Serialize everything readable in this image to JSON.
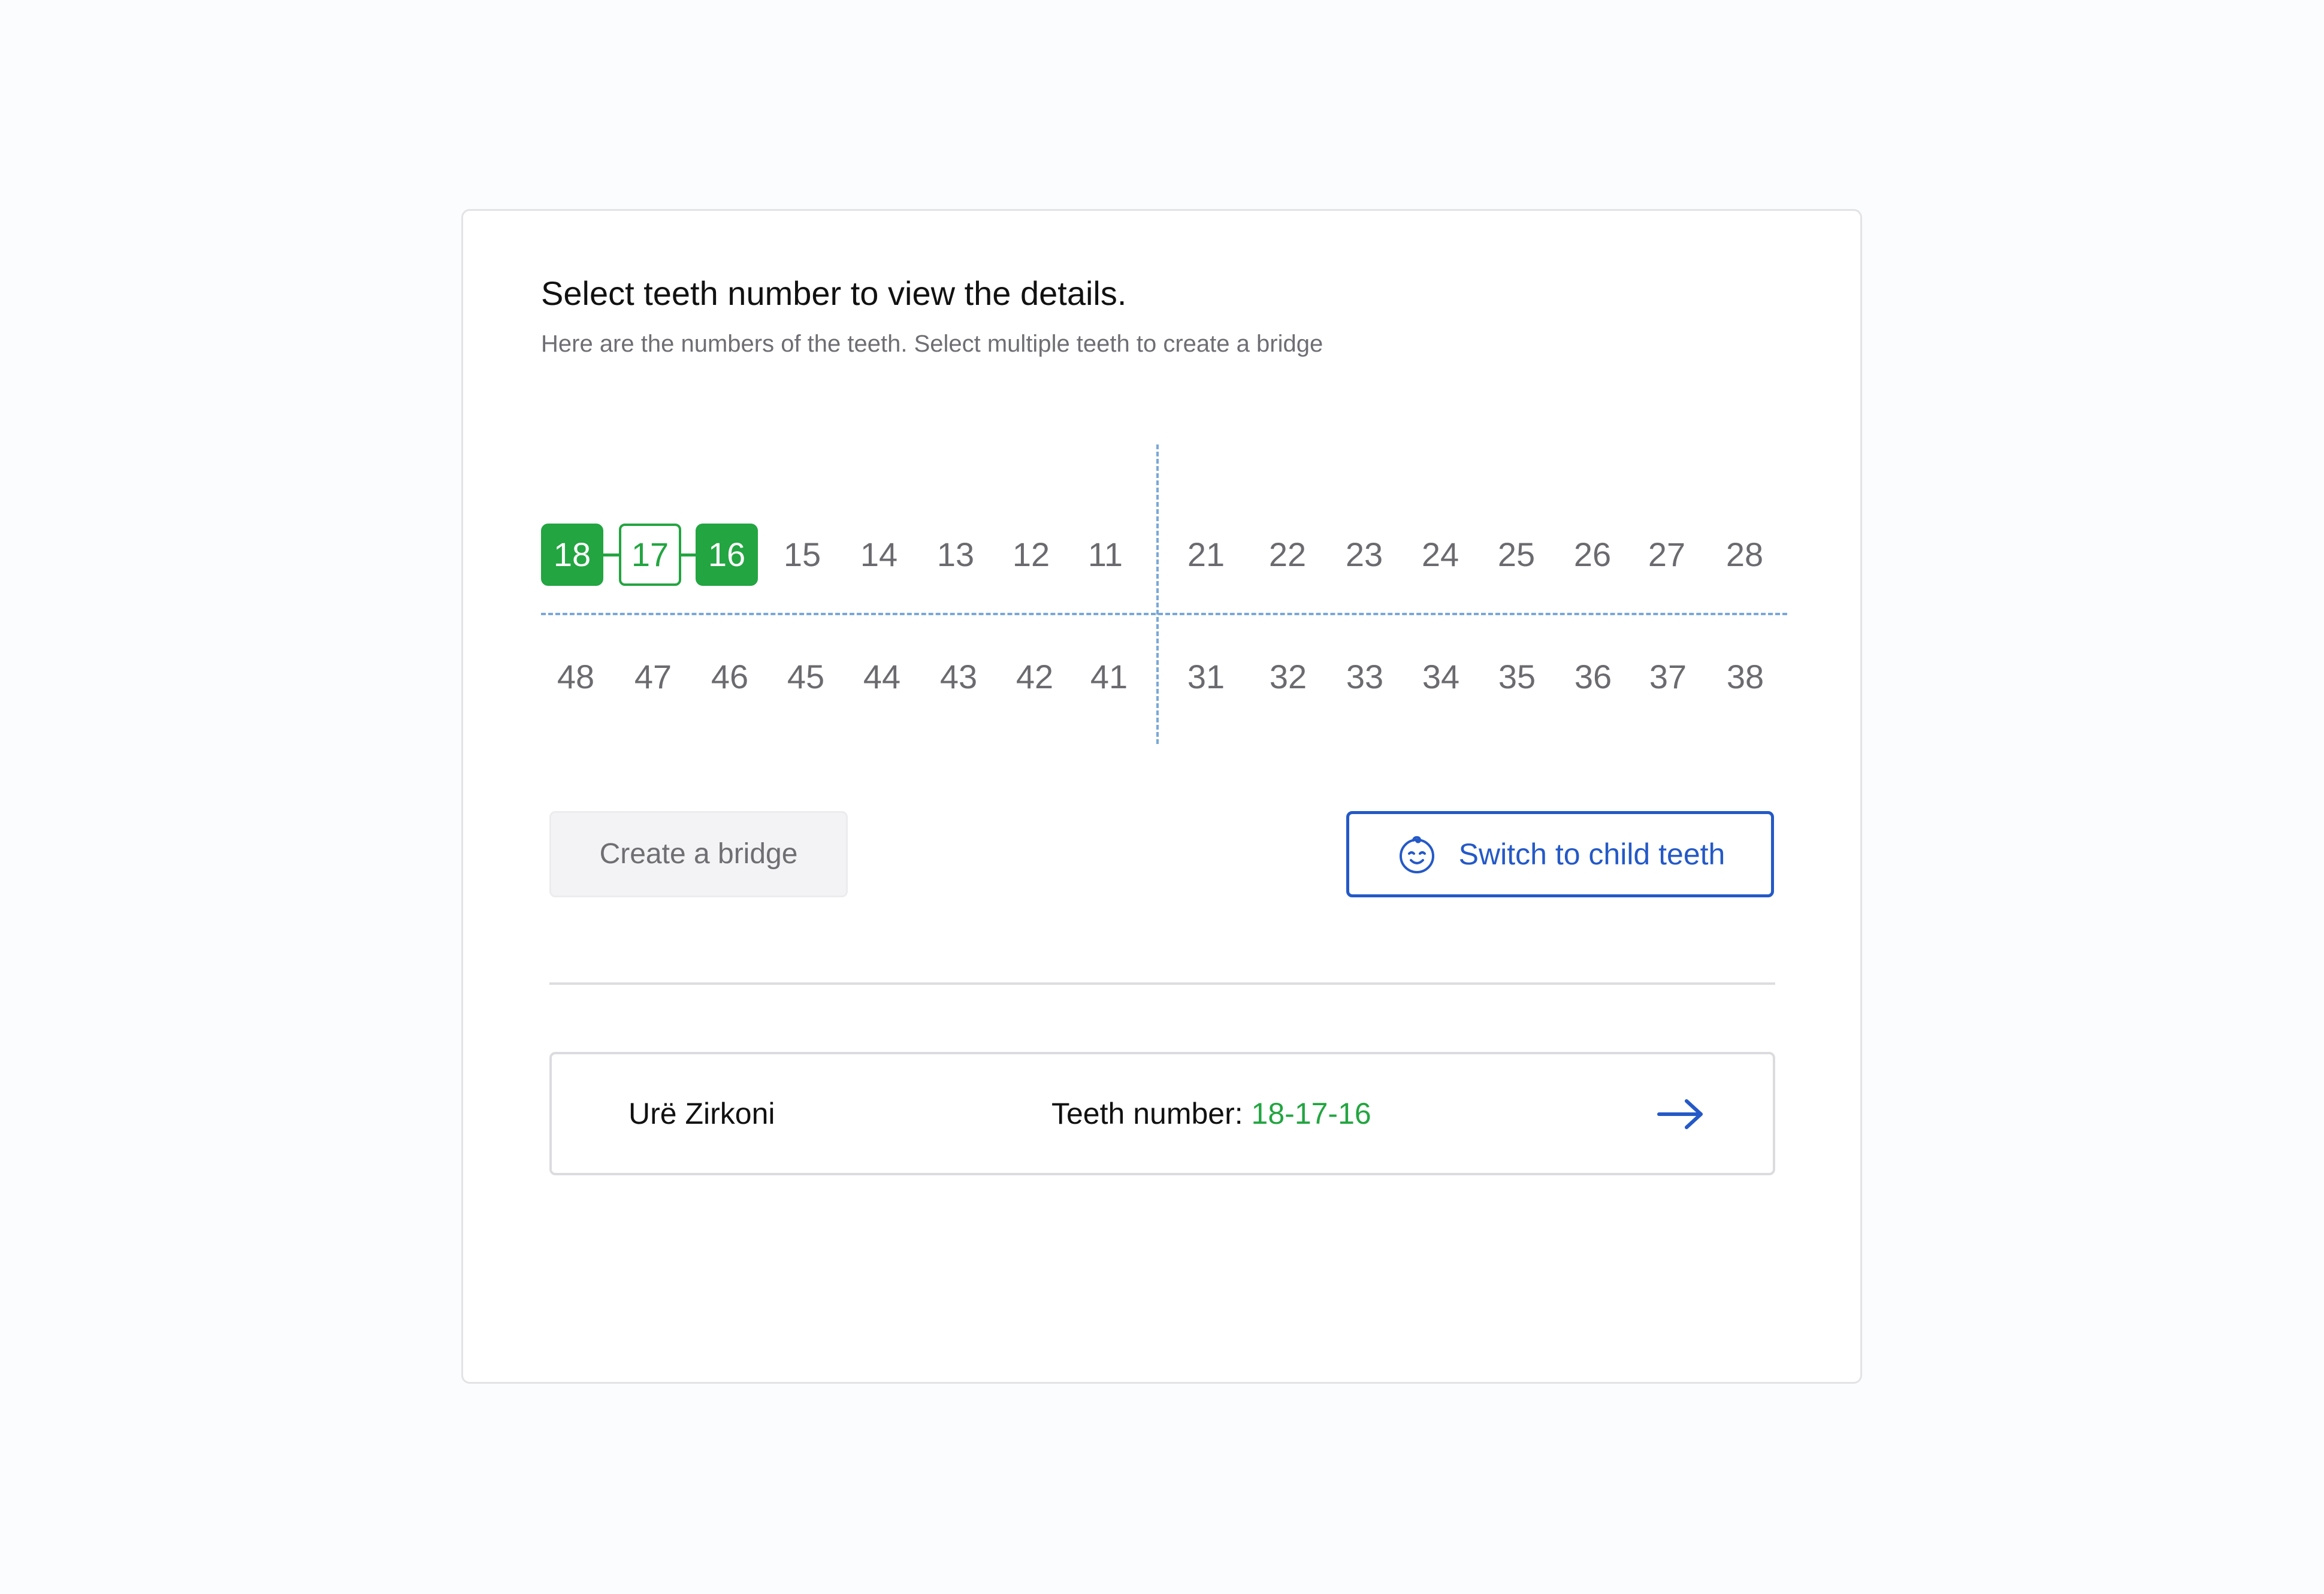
{
  "header": {
    "title": "Select teeth number to view the details.",
    "subtitle": "Here are the numbers of the teeth. Select multiple teeth to create a bridge"
  },
  "teeth": {
    "upper": [
      "18",
      "17",
      "16",
      "15",
      "14",
      "13",
      "12",
      "11",
      "21",
      "22",
      "23",
      "24",
      "25",
      "26",
      "27",
      "28"
    ],
    "lower": [
      "48",
      "47",
      "46",
      "45",
      "44",
      "43",
      "42",
      "41",
      "31",
      "32",
      "33",
      "34",
      "35",
      "36",
      "37",
      "38"
    ],
    "selected_filled": [
      "18",
      "16"
    ],
    "selected_outlined": [
      "17"
    ]
  },
  "actions": {
    "create_bridge_label": "Create a bridge",
    "switch_child_label": "Switch to child teeth",
    "switch_child_icon": "baby-face-icon"
  },
  "result": {
    "name": "Urë Zirkoni",
    "teeth_label": "Teeth number:",
    "teeth_value": "18-17-16",
    "arrow_icon": "arrow-right-icon"
  },
  "colors": {
    "selected_green": "#23a541",
    "accent_blue": "#2459c7",
    "guide_blue": "#7aa8d6"
  }
}
